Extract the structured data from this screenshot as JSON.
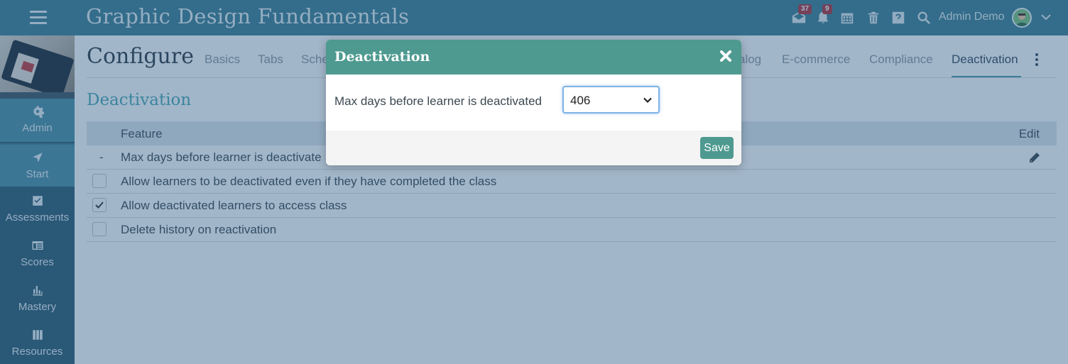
{
  "app": {
    "title": "Graphic Design Fundamentals"
  },
  "topbar": {
    "messages_badge": "37",
    "alerts_badge": "9",
    "user_name": "Admin Demo"
  },
  "sidebar": {
    "items": [
      {
        "label": "Admin",
        "icon": "gear-icon"
      },
      {
        "label": "Start",
        "icon": "paper-plane-icon"
      },
      {
        "label": "Assessments",
        "icon": "checkbox-icon"
      },
      {
        "label": "Scores",
        "icon": "gradebook-icon"
      },
      {
        "label": "Mastery",
        "icon": "bar-chart-icon"
      },
      {
        "label": "Resources",
        "icon": "library-icon"
      }
    ]
  },
  "page": {
    "title": "Configure",
    "tabs": [
      {
        "label": "Basics"
      },
      {
        "label": "Tabs"
      },
      {
        "label": "Sche"
      },
      {
        "label": "alog"
      },
      {
        "label": "E-commerce"
      },
      {
        "label": "Compliance"
      },
      {
        "label": "Deactivation"
      }
    ],
    "active_tab": "Deactivation",
    "section_heading": "Deactivation"
  },
  "table": {
    "headers": {
      "feature": "Feature",
      "edit": "Edit"
    },
    "rows": [
      {
        "type": "value",
        "marker": "-",
        "label": "Max days before learner is deactivate",
        "editable": true
      },
      {
        "type": "checkbox",
        "checked": false,
        "label": "Allow learners to be deactivated even if they have completed the class"
      },
      {
        "type": "checkbox",
        "checked": true,
        "label": "Allow deactivated learners to access class"
      },
      {
        "type": "checkbox",
        "checked": false,
        "label": "Delete history on reactivation"
      }
    ]
  },
  "modal": {
    "title": "Deactivation",
    "field_label": "Max days before learner is deactivated",
    "select_value": "406",
    "save_label": "Save"
  },
  "colors": {
    "topbar": "#3d7f92",
    "sidebar": "#2d5a6f",
    "accent": "#4e9a90",
    "heading": "#4aa8b3"
  }
}
